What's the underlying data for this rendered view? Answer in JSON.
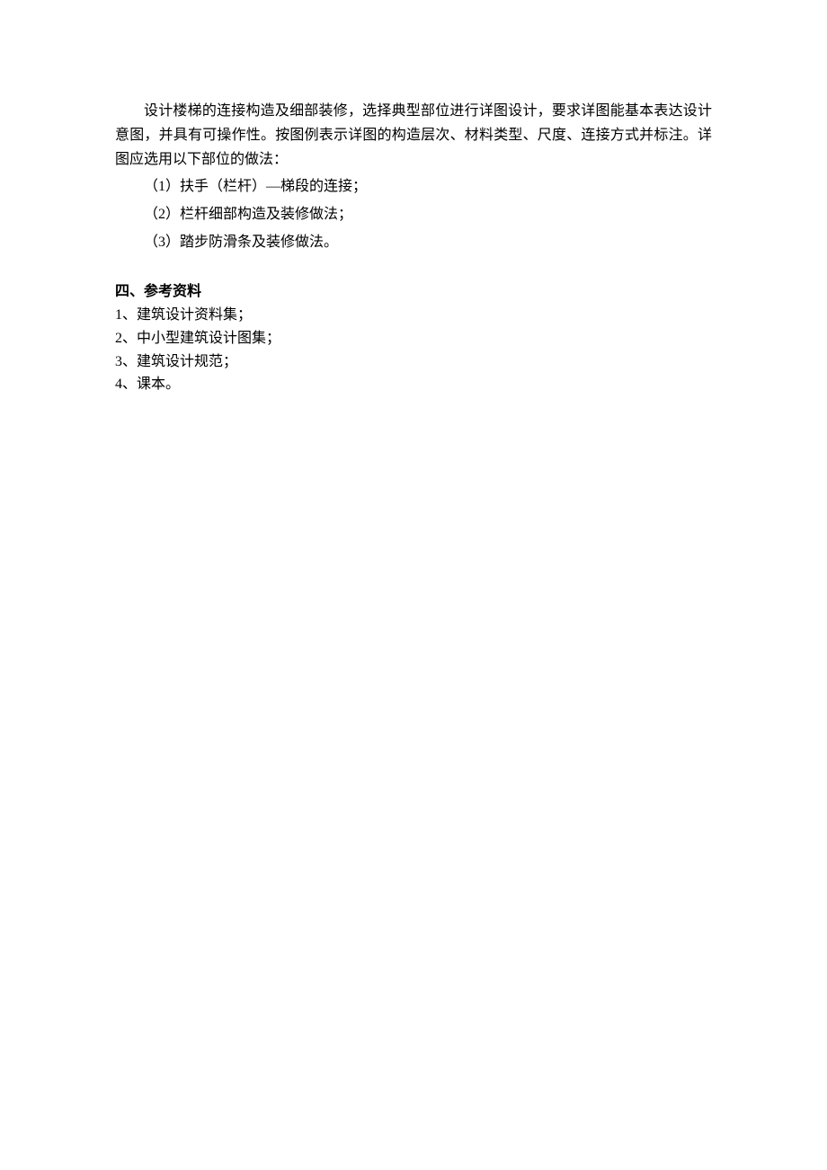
{
  "paragraph1": "设计楼梯的连接构造及细部装修，选择典型部位进行详图设计，要求详图能基本表达设计意图，并具有可操作性。按图例表示详图的构造层次、材料类型、尺度、连接方式并标注。详图应选用以下部位的做法：",
  "items": [
    "（1）扶手（栏杆）—梯段的连接；",
    "（2）栏杆细部构造及装修做法；",
    "（3）踏步防滑条及装修做法。"
  ],
  "sectionHeader": "四、参考资料",
  "references": [
    "1、建筑设计资料集；",
    "2、中小型建筑设计图集；",
    "3、建筑设计规范；",
    "4、课本。"
  ]
}
